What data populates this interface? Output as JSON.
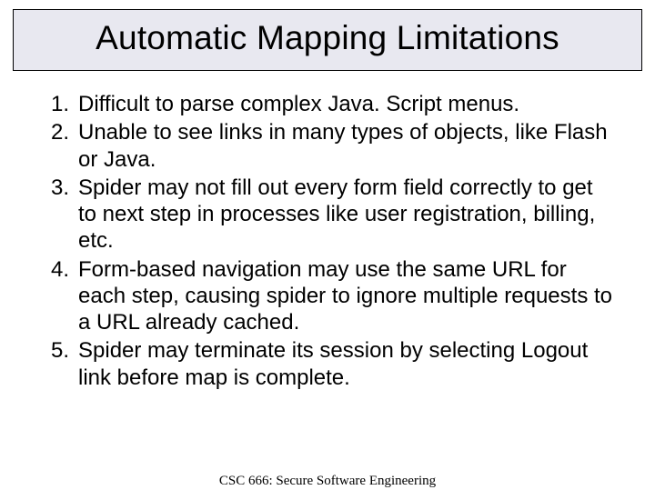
{
  "title": "Automatic Mapping Limitations",
  "items": [
    "Difficult to parse complex Java. Script menus.",
    "Unable to see links in many types of objects, like Flash or Java.",
    "Spider may not fill out every form field correctly to get to next step in processes like user registration, billing, etc.",
    "Form-based navigation may use the same URL for each step, causing spider to ignore multiple requests to a URL already cached.",
    "Spider may terminate its session by selecting Logout link before map is complete."
  ],
  "footer": "CSC 666: Secure Software Engineering"
}
